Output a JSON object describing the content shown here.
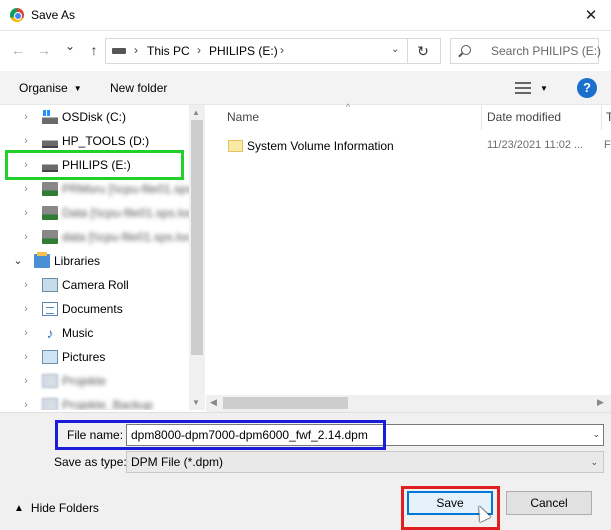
{
  "window": {
    "title": "Save As",
    "close_glyph": "✕"
  },
  "nav": {
    "back_glyph": "←",
    "forward_glyph": "→",
    "recent_glyph": "⌄",
    "up_glyph": "↑",
    "breadcrumbs": [
      "This PC",
      "PHILIPS (E:)"
    ],
    "refresh_glyph": "↻",
    "search_placeholder": "Search PHILIPS (E:)"
  },
  "toolbar": {
    "organise_label": "Organise",
    "new_folder_label": "New folder",
    "help_label": "?"
  },
  "tree": {
    "items": [
      {
        "label": "OSDisk (C:)",
        "icon": "os-drive-icon"
      },
      {
        "label": "HP_TOOLS (D:)",
        "icon": "drive-icon"
      },
      {
        "label": "PHILIPS (E:)",
        "icon": "drive-icon"
      },
      {
        "label": "PRMsru [\\\\cpu-file01.sps",
        "icon": "network-drive-icon"
      },
      {
        "label": "Data [\\\\cpu-file01.sps.loc",
        "icon": "network-drive-icon"
      },
      {
        "label": "data [\\\\cpu-file01.sps.loc",
        "icon": "network-drive-icon"
      },
      {
        "label": "Libraries",
        "icon": "libraries-icon"
      },
      {
        "label": "Camera Roll",
        "icon": "camera-roll-icon"
      },
      {
        "label": "Documents",
        "icon": "documents-icon"
      },
      {
        "label": "Music",
        "icon": "music-icon"
      },
      {
        "label": "Pictures",
        "icon": "pictures-icon"
      },
      {
        "label": "Projekte",
        "icon": "library-folder-icon"
      },
      {
        "label": "Projekte_Backup",
        "icon": "library-folder-icon"
      }
    ]
  },
  "file_list": {
    "columns": [
      "Name",
      "Date modified",
      "T"
    ],
    "rows": [
      {
        "name": "System Volume Information",
        "date": "11/23/2021 11:02 ...",
        "type": "F"
      }
    ]
  },
  "form": {
    "file_name_label": "File name:",
    "file_name_value": "dpm8000-dpm7000-dpm6000_fwf_2.14.dpm",
    "save_type_label": "Save as type:",
    "save_type_value": "DPM File (*.dpm)"
  },
  "footer": {
    "hide_folders_label": "Hide Folders",
    "save_label": "Save",
    "cancel_label": "Cancel"
  },
  "highlights": {
    "green": "#22d02a",
    "blue": "#1b1bd8",
    "red": "#e02020"
  }
}
